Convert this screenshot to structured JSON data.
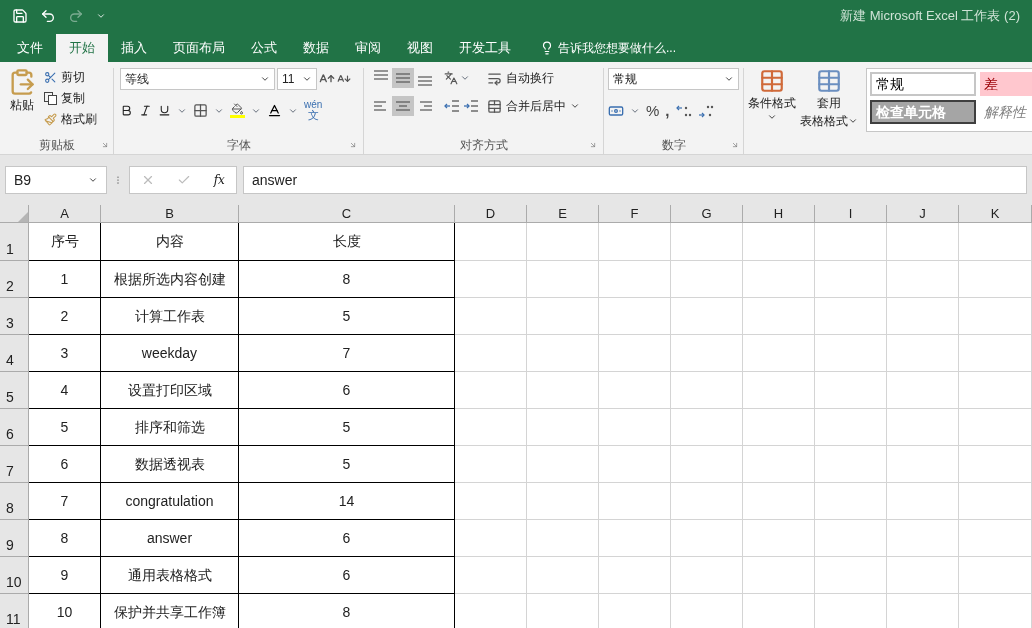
{
  "window": {
    "title": "新建 Microsoft Excel 工作表 (2)"
  },
  "tabs": [
    {
      "label": "文件",
      "selected": false
    },
    {
      "label": "开始",
      "selected": true
    },
    {
      "label": "插入",
      "selected": false
    },
    {
      "label": "页面布局",
      "selected": false
    },
    {
      "label": "公式",
      "selected": false
    },
    {
      "label": "数据",
      "selected": false
    },
    {
      "label": "审阅",
      "selected": false
    },
    {
      "label": "视图",
      "selected": false
    },
    {
      "label": "开发工具",
      "selected": false
    }
  ],
  "tell_me": "告诉我您想要做什么...",
  "clipboard": {
    "paste": "粘贴",
    "cut": "剪切",
    "copy": "复制",
    "format_painter": "格式刷",
    "label": "剪贴板"
  },
  "font": {
    "font_name": "等线",
    "font_size": "11",
    "phonetic_top": "wén",
    "phonetic_bottom": "文",
    "label": "字体"
  },
  "alignment": {
    "vertical": [
      {
        "selected": false
      },
      {
        "selected": true
      },
      {
        "selected": false
      }
    ],
    "horizontal": [
      {
        "selected": false
      },
      {
        "selected": true
      },
      {
        "selected": false
      }
    ],
    "wrap": "自动换行",
    "merge": "合并后居中",
    "label": "对齐方式"
  },
  "number": {
    "format": "常规",
    "percent": "%",
    "comma": ",",
    "label": "数字"
  },
  "styles": {
    "conditional": "条件格式",
    "table_top": "套用",
    "table_bottom": "表格格式",
    "cells": [
      {
        "text": "常规",
        "kind": "normal"
      },
      {
        "text": "差",
        "kind": "bad"
      },
      {
        "text": "检查单元格",
        "kind": "check"
      },
      {
        "text": "解释性",
        "kind": "note"
      }
    ]
  },
  "formula_bar": {
    "name_box": "B9",
    "function_label": "fx",
    "value": "answer"
  },
  "columns": [
    "A",
    "B",
    "C",
    "D",
    "E",
    "F",
    "G",
    "H",
    "I",
    "J",
    "K"
  ],
  "rows": [
    {
      "number": "1",
      "cells": [
        "序号",
        "内容",
        "长度"
      ]
    },
    {
      "number": "2",
      "cells": [
        "1",
        "根据所选内容创建",
        "8"
      ]
    },
    {
      "number": "3",
      "cells": [
        "2",
        "计算工作表",
        "5"
      ]
    },
    {
      "number": "4",
      "cells": [
        "3",
        "weekday",
        "7"
      ]
    },
    {
      "number": "5",
      "cells": [
        "4",
        "设置打印区域",
        "6"
      ]
    },
    {
      "number": "6",
      "cells": [
        "5",
        "排序和筛选",
        "5"
      ]
    },
    {
      "number": "7",
      "cells": [
        "6",
        "数据透视表",
        "5"
      ]
    },
    {
      "number": "8",
      "cells": [
        "7",
        "congratulation",
        "14"
      ]
    },
    {
      "number": "9",
      "cells": [
        "8",
        "answer",
        "6"
      ]
    },
    {
      "number": "10",
      "cells": [
        "9",
        "通用表格格式",
        "6"
      ]
    },
    {
      "number": "11",
      "cells": [
        "10",
        "保护并共享工作簿",
        "8"
      ]
    }
  ]
}
